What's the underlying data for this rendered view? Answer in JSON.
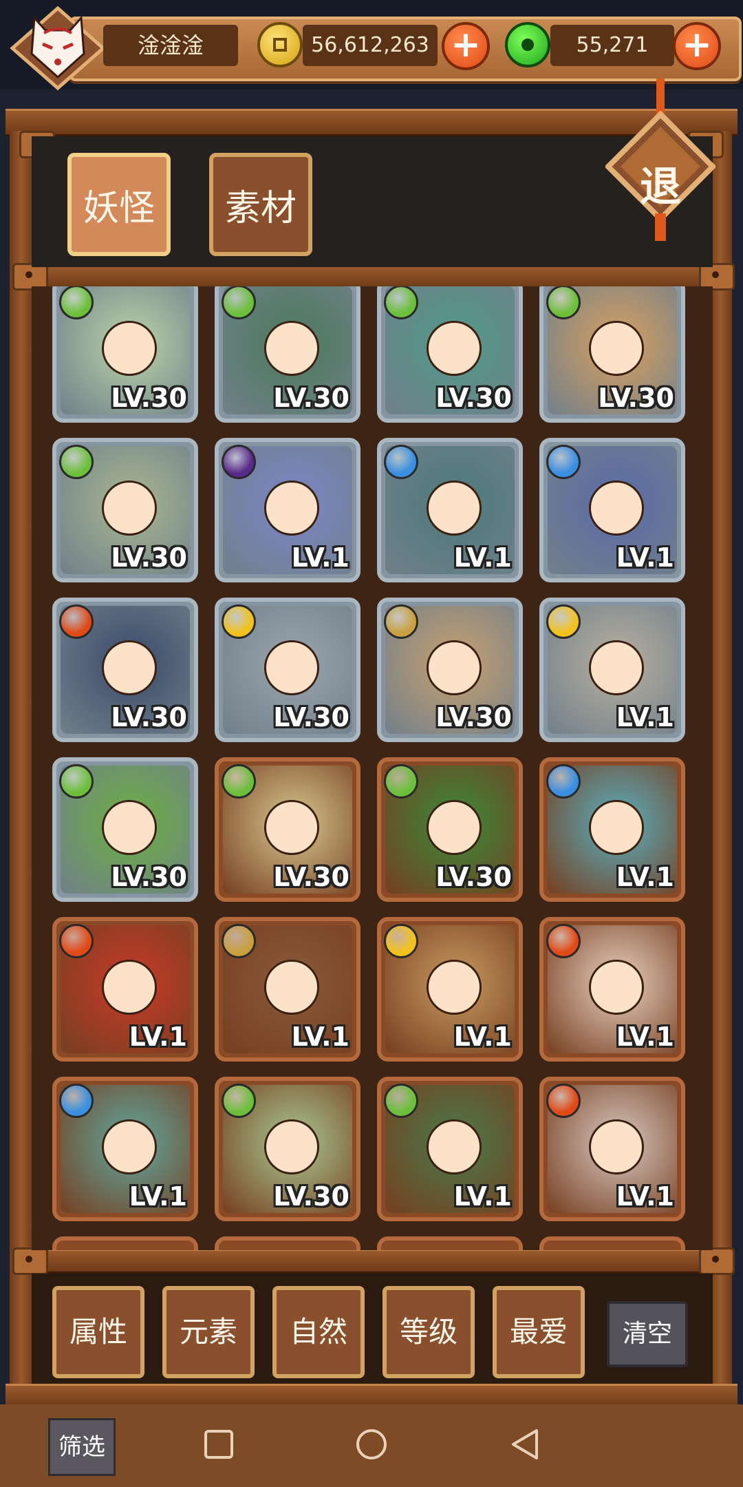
{
  "player": {
    "name": "淦淦淦"
  },
  "currency": {
    "gold": "56,612,263",
    "jade": "55,271"
  },
  "tabs": [
    {
      "label": "妖怪"
    },
    {
      "label": "素材"
    }
  ],
  "exit": {
    "label": "退"
  },
  "cards": [
    {
      "lv": "LV.30",
      "element": "leaf",
      "frame": "silver",
      "color": "#b9d4a8"
    },
    {
      "lv": "LV.30",
      "element": "leaf",
      "frame": "silver",
      "color": "#4a7a5a"
    },
    {
      "lv": "LV.30",
      "element": "leaf",
      "frame": "silver",
      "color": "#4f9a8a"
    },
    {
      "lv": "LV.30",
      "element": "leaf",
      "frame": "silver",
      "color": "#d8a060"
    },
    {
      "lv": "LV.30",
      "element": "leaf",
      "frame": "silver",
      "color": "#a8b890"
    },
    {
      "lv": "LV.1",
      "element": "moon",
      "frame": "silver",
      "color": "#7a86c8"
    },
    {
      "lv": "LV.1",
      "element": "water",
      "frame": "silver",
      "color": "#4a7a7a"
    },
    {
      "lv": "LV.1",
      "element": "water",
      "frame": "silver",
      "color": "#5a6aa8"
    },
    {
      "lv": "LV.30",
      "element": "fire",
      "frame": "silver",
      "color": "#3a4a6a"
    },
    {
      "lv": "LV.30",
      "element": "sun",
      "frame": "silver",
      "color": "#9aa4ae"
    },
    {
      "lv": "LV.30",
      "element": "earth",
      "frame": "silver",
      "color": "#c8a070"
    },
    {
      "lv": "LV.1",
      "element": "sun",
      "frame": "silver",
      "color": "#b8b0a0"
    },
    {
      "lv": "LV.30",
      "element": "leaf",
      "frame": "silver",
      "color": "#6ab040"
    },
    {
      "lv": "LV.30",
      "element": "leaf",
      "frame": "bronze",
      "color": "#d8c890"
    },
    {
      "lv": "LV.30",
      "element": "leaf",
      "frame": "bronze",
      "color": "#3a8a3a"
    },
    {
      "lv": "LV.1",
      "element": "water",
      "frame": "bronze",
      "color": "#5ab0c0"
    },
    {
      "lv": "LV.1",
      "element": "fire",
      "frame": "bronze",
      "color": "#c83a2a"
    },
    {
      "lv": "LV.1",
      "element": "earth",
      "frame": "bronze",
      "color": "#8a5a3a"
    },
    {
      "lv": "LV.1",
      "element": "sun",
      "frame": "bronze",
      "color": "#c89a60"
    },
    {
      "lv": "LV.1",
      "element": "fire",
      "frame": "bronze",
      "color": "#e8d0c0"
    },
    {
      "lv": "LV.1",
      "element": "water",
      "frame": "bronze",
      "color": "#60a8a0"
    },
    {
      "lv": "LV.30",
      "element": "leaf",
      "frame": "bronze",
      "color": "#a8c890"
    },
    {
      "lv": "LV.1",
      "element": "leaf",
      "frame": "bronze",
      "color": "#4a7a4a"
    },
    {
      "lv": "LV.1",
      "element": "fire",
      "frame": "bronze",
      "color": "#d8c8c0"
    }
  ],
  "filters": [
    {
      "label": "属性"
    },
    {
      "label": "元素"
    },
    {
      "label": "自然"
    },
    {
      "label": "等级"
    },
    {
      "label": "最爱"
    }
  ],
  "clear": {
    "label": "清空"
  },
  "sift": {
    "label": "筛选"
  },
  "colors": {
    "wood": "#8a4f2c",
    "gold_trim": "#d2a260",
    "leaf": "#6cbf3a",
    "water": "#3a8fe0",
    "fire": "#e04a16",
    "sun": "#f2c21a",
    "earth": "#c8a040",
    "moon": "#5a2a8a"
  }
}
